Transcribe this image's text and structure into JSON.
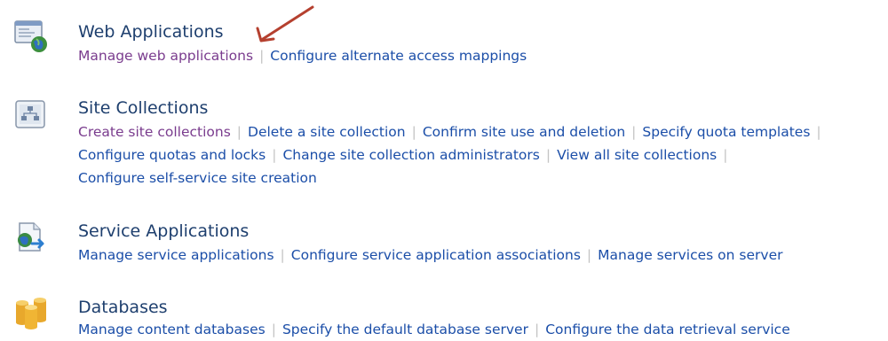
{
  "sections": [
    {
      "title": "Web Applications",
      "icon": "web-application-globe-icon",
      "lines": [
        [
          "Manage web applications",
          "Configure alternate access mappings"
        ]
      ]
    },
    {
      "title": "Site Collections",
      "icon": "site-hierarchy-icon",
      "lines": [
        [
          "Create site collections",
          "Delete a site collection",
          "Confirm site use and deletion",
          "Specify quota templates"
        ],
        [
          "Configure quotas and locks",
          "Change site collection administrators",
          "View all site collections"
        ],
        [
          "Configure self-service site creation"
        ]
      ]
    },
    {
      "title": "Service Applications",
      "icon": "service-application-icon",
      "lines": [
        [
          "Manage service applications",
          "Configure service application associations",
          "Manage services on server"
        ]
      ]
    },
    {
      "title": "Databases",
      "icon": "database-cylinders-icon",
      "lines": [
        [
          "Manage content databases",
          "Specify the default database server",
          "Configure the data retrieval service"
        ]
      ]
    }
  ],
  "annotation": {
    "arrow_color": "#b5402f",
    "arrow_target": "Manage web applications"
  },
  "colors": {
    "title": "#1e3f6e",
    "link": "#1b4ea8",
    "visited_link": "#7a3c8e",
    "separator": "#c4c4c4"
  }
}
